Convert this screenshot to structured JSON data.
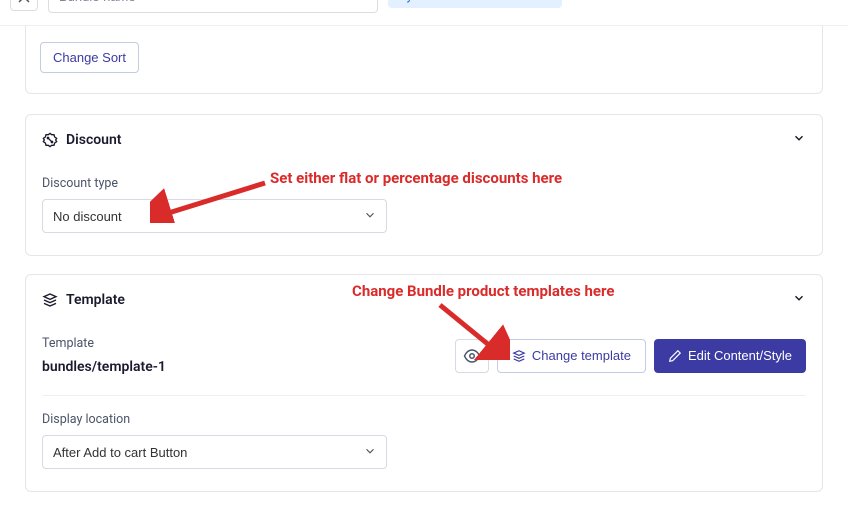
{
  "top": {
    "name_placeholder": "Bundle name",
    "badge": "Dynamic Cross-sell Bundle"
  },
  "partial": {
    "change_sort": "Change Sort"
  },
  "discount": {
    "title": "Discount",
    "type_label": "Discount type",
    "type_value": "No discount"
  },
  "template": {
    "title": "Template",
    "field_label": "Template",
    "value": "bundles/template-1",
    "change_btn": "Change template",
    "edit_btn": "Edit Content/Style",
    "location_label": "Display location",
    "location_value": "After Add to cart Button"
  },
  "annotations": {
    "discount_note": "Set either flat or percentage discounts here",
    "template_note": "Change Bundle product templates here"
  }
}
